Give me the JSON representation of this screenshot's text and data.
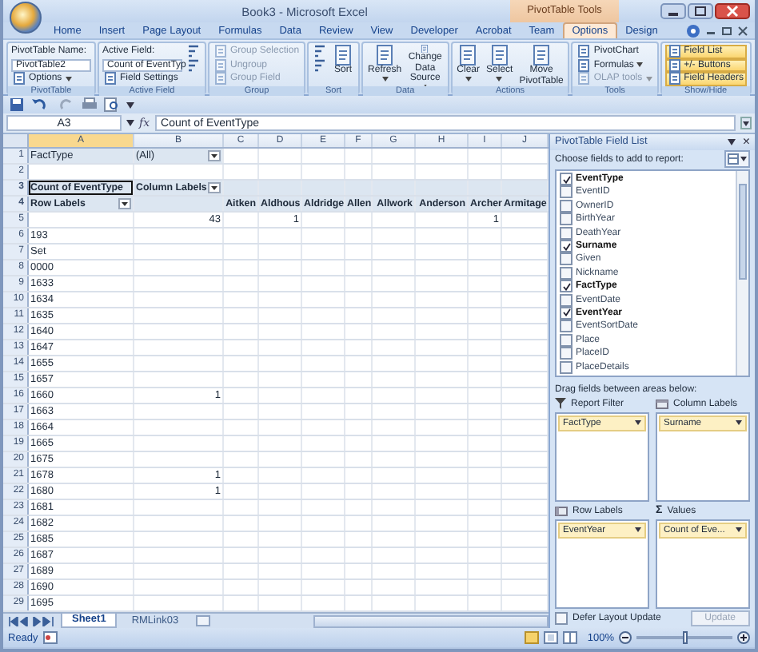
{
  "window": {
    "title": "Book3 - Microsoft Excel",
    "context_label": "PivotTable Tools"
  },
  "tabs": [
    {
      "label": "Home",
      "selected": false
    },
    {
      "label": "Insert",
      "selected": false
    },
    {
      "label": "Page Layout",
      "selected": false
    },
    {
      "label": "Formulas",
      "selected": false
    },
    {
      "label": "Data",
      "selected": false
    },
    {
      "label": "Review",
      "selected": false
    },
    {
      "label": "View",
      "selected": false
    },
    {
      "label": "Developer",
      "selected": false
    },
    {
      "label": "Acrobat",
      "selected": false
    },
    {
      "label": "Team",
      "selected": false
    },
    {
      "label": "Options",
      "selected": true
    },
    {
      "label": "Design",
      "selected": false
    }
  ],
  "ribbon": [
    {
      "label": "PivotTable",
      "items": [
        {
          "kind": "caption",
          "text": "PivotTable Name:"
        },
        {
          "kind": "field",
          "text": "PivotTable2"
        },
        {
          "kind": "small",
          "text": "Options",
          "menu": true,
          "disabled": false
        }
      ]
    },
    {
      "label": "Active Field",
      "items": [
        {
          "kind": "caption",
          "text": "Active Field:"
        },
        {
          "kind": "field",
          "text": "Count of EventTyp"
        },
        {
          "kind": "small",
          "text": "Field Settings",
          "menu": false,
          "disabled": false
        },
        {
          "kind": "icon",
          "disabled": false
        },
        {
          "kind": "icon",
          "disabled": false
        }
      ]
    },
    {
      "label": "Group",
      "items": [
        {
          "kind": "small",
          "text": "Group Selection",
          "menu": false,
          "disabled": true
        },
        {
          "kind": "small",
          "text": "Ungroup",
          "menu": false,
          "disabled": true
        },
        {
          "kind": "small",
          "text": "Group Field",
          "menu": false,
          "disabled": true
        }
      ]
    },
    {
      "label": "Sort",
      "items": [
        {
          "kind": "icon",
          "disabled": false
        },
        {
          "kind": "icon",
          "disabled": false
        },
        {
          "kind": "large",
          "text": "Sort",
          "menu": false,
          "disabled": false
        }
      ]
    },
    {
      "label": "Data",
      "items": [
        {
          "kind": "large",
          "text": "Refresh",
          "menu": true,
          "disabled": false
        },
        {
          "kind": "large",
          "text": "Change Data Source",
          "menu": true,
          "disabled": false
        }
      ]
    },
    {
      "label": "Actions",
      "items": [
        {
          "kind": "large",
          "text": "Clear",
          "menu": true,
          "disabled": false
        },
        {
          "kind": "large",
          "text": "Select",
          "menu": true,
          "disabled": false
        },
        {
          "kind": "large",
          "text": "Move PivotTable",
          "menu": false,
          "disabled": false
        }
      ]
    },
    {
      "label": "Tools",
      "items": [
        {
          "kind": "small",
          "text": "PivotChart",
          "menu": false,
          "disabled": false
        },
        {
          "kind": "small",
          "text": "Formulas",
          "menu": true,
          "disabled": false
        },
        {
          "kind": "small",
          "text": "OLAP tools",
          "menu": true,
          "disabled": true
        }
      ]
    },
    {
      "label": "Show/Hide",
      "items": [
        {
          "kind": "toggle",
          "text": "Field List",
          "on": true
        },
        {
          "kind": "toggle",
          "text": "+/- Buttons",
          "on": true
        },
        {
          "kind": "toggle",
          "text": "Field Headers",
          "on": true
        }
      ]
    }
  ],
  "formula_bar": {
    "name_box": "A3",
    "function_label": "fx",
    "value": "Count of EventType"
  },
  "columns": [
    "A",
    "B",
    "C",
    "D",
    "E",
    "F",
    "G",
    "H",
    "I",
    "J"
  ],
  "rows": [
    {
      "n": "1",
      "kind": "filter",
      "cells": [
        {
          "text": "FactType",
          "dropdown": false,
          "selected": false
        },
        {
          "text": "(All)",
          "dropdown": true,
          "selected": false
        }
      ]
    },
    {
      "n": "2",
      "kind": "data",
      "cells": []
    },
    {
      "n": "3",
      "kind": "header",
      "cells": [
        {
          "text": "Count of EventType",
          "dropdown": false,
          "selected": true
        },
        {
          "text": "Column Labels",
          "dropdown": true,
          "selected": false
        }
      ]
    },
    {
      "n": "4",
      "kind": "columns",
      "cells": [
        {
          "text": "Row Labels",
          "dropdown": true,
          "selected": false
        },
        null,
        {
          "text": "Aitken",
          "dropdown": false,
          "selected": false
        },
        {
          "text": "Aldhous",
          "dropdown": false,
          "selected": false
        },
        {
          "text": "Aldridge",
          "dropdown": false,
          "selected": false
        },
        {
          "text": "Allen",
          "dropdown": false,
          "selected": false
        },
        {
          "text": "Allwork",
          "dropdown": false,
          "selected": false
        },
        {
          "text": "Anderson",
          "dropdown": false,
          "selected": false
        },
        {
          "text": "Archer",
          "dropdown": false,
          "selected": false
        },
        {
          "text": "Armitage",
          "dropdown": false,
          "selected": false
        }
      ]
    },
    {
      "n": "5",
      "kind": "data",
      "cells": [
        null,
        {
          "text": "43",
          "dropdown": false,
          "selected": false
        },
        null,
        {
          "text": "1",
          "dropdown": false,
          "selected": false
        },
        null,
        null,
        null,
        null,
        {
          "text": "1",
          "dropdown": false,
          "selected": false
        }
      ]
    },
    {
      "n": "6",
      "kind": "data",
      "cells": [
        {
          "text": "193",
          "dropdown": false,
          "selected": false
        }
      ]
    },
    {
      "n": "7",
      "kind": "data",
      "cells": [
        {
          "text": "Set",
          "dropdown": false,
          "selected": false
        }
      ]
    },
    {
      "n": "8",
      "kind": "data",
      "cells": [
        {
          "text": "0000",
          "dropdown": false,
          "selected": false
        }
      ]
    },
    {
      "n": "9",
      "kind": "data",
      "cells": [
        {
          "text": "1633",
          "dropdown": false,
          "selected": false
        }
      ]
    },
    {
      "n": "10",
      "kind": "data",
      "cells": [
        {
          "text": "1634",
          "dropdown": false,
          "selected": false
        }
      ]
    },
    {
      "n": "11",
      "kind": "data",
      "cells": [
        {
          "text": "1635",
          "dropdown": false,
          "selected": false
        }
      ]
    },
    {
      "n": "12",
      "kind": "data",
      "cells": [
        {
          "text": "1640",
          "dropdown": false,
          "selected": false
        }
      ]
    },
    {
      "n": "13",
      "kind": "data",
      "cells": [
        {
          "text": "1647",
          "dropdown": false,
          "selected": false
        }
      ]
    },
    {
      "n": "14",
      "kind": "data",
      "cells": [
        {
          "text": "1655",
          "dropdown": false,
          "selected": false
        }
      ]
    },
    {
      "n": "15",
      "kind": "data",
      "cells": [
        {
          "text": "1657",
          "dropdown": false,
          "selected": false
        }
      ]
    },
    {
      "n": "16",
      "kind": "data",
      "cells": [
        {
          "text": "1660",
          "dropdown": false,
          "selected": false
        },
        {
          "text": "1",
          "dropdown": false,
          "selected": false
        }
      ]
    },
    {
      "n": "17",
      "kind": "data",
      "cells": [
        {
          "text": "1663",
          "dropdown": false,
          "selected": false
        }
      ]
    },
    {
      "n": "18",
      "kind": "data",
      "cells": [
        {
          "text": "1664",
          "dropdown": false,
          "selected": false
        }
      ]
    },
    {
      "n": "19",
      "kind": "data",
      "cells": [
        {
          "text": "1665",
          "dropdown": false,
          "selected": false
        }
      ]
    },
    {
      "n": "20",
      "kind": "data",
      "cells": [
        {
          "text": "1675",
          "dropdown": false,
          "selected": false
        }
      ]
    },
    {
      "n": "21",
      "kind": "data",
      "cells": [
        {
          "text": "1678",
          "dropdown": false,
          "selected": false
        },
        {
          "text": "1",
          "dropdown": false,
          "selected": false
        }
      ]
    },
    {
      "n": "22",
      "kind": "data",
      "cells": [
        {
          "text": "1680",
          "dropdown": false,
          "selected": false
        },
        {
          "text": "1",
          "dropdown": false,
          "selected": false
        }
      ]
    },
    {
      "n": "23",
      "kind": "data",
      "cells": [
        {
          "text": "1681",
          "dropdown": false,
          "selected": false
        }
      ]
    },
    {
      "n": "24",
      "kind": "data",
      "cells": [
        {
          "text": "1682",
          "dropdown": false,
          "selected": false
        }
      ]
    },
    {
      "n": "25",
      "kind": "data",
      "cells": [
        {
          "text": "1685",
          "dropdown": false,
          "selected": false
        }
      ]
    },
    {
      "n": "26",
      "kind": "data",
      "cells": [
        {
          "text": "1687",
          "dropdown": false,
          "selected": false
        }
      ]
    },
    {
      "n": "27",
      "kind": "data",
      "cells": [
        {
          "text": "1689",
          "dropdown": false,
          "selected": false
        }
      ]
    },
    {
      "n": "28",
      "kind": "data",
      "cells": [
        {
          "text": "1690",
          "dropdown": false,
          "selected": false
        }
      ]
    },
    {
      "n": "29",
      "kind": "data",
      "cells": [
        {
          "text": "1695",
          "dropdown": false,
          "selected": false
        }
      ]
    }
  ],
  "sheet_tabs": [
    {
      "label": "Sheet1",
      "selected": true
    },
    {
      "label": "RMLink03",
      "selected": false
    }
  ],
  "field_list": {
    "title": "PivotTable Field List",
    "close": "×",
    "choose_label": "Choose fields to add to report:",
    "fields": [
      {
        "name": "EventType",
        "checked": true
      },
      {
        "name": "EventID",
        "checked": false
      },
      {
        "name": "OwnerID",
        "checked": false
      },
      {
        "name": "BirthYear",
        "checked": false
      },
      {
        "name": "DeathYear",
        "checked": false
      },
      {
        "name": "Surname",
        "checked": true
      },
      {
        "name": "Given",
        "checked": false
      },
      {
        "name": "Nickname",
        "checked": false
      },
      {
        "name": "FactType",
        "checked": true
      },
      {
        "name": "EventDate",
        "checked": false
      },
      {
        "name": "EventYear",
        "checked": true
      },
      {
        "name": "EventSortDate",
        "checked": false
      },
      {
        "name": "Place",
        "checked": false
      },
      {
        "name": "PlaceID",
        "checked": false
      },
      {
        "name": "PlaceDetails",
        "checked": false
      }
    ],
    "drag_label": "Drag fields between areas below:",
    "areas": [
      {
        "kind": "filter",
        "label": "Report Filter",
        "fields": [
          "FactType"
        ]
      },
      {
        "kind": "columns",
        "label": "Column Labels",
        "fields": [
          "Surname"
        ]
      },
      {
        "kind": "rows",
        "label": "Row Labels",
        "fields": [
          "EventYear"
        ]
      },
      {
        "kind": "values",
        "label": "Values",
        "symbol": "Σ",
        "fields": [
          "Count of Eve..."
        ]
      }
    ],
    "defer": {
      "label": "Defer Layout Update",
      "checked": false
    },
    "update": {
      "label": "Update",
      "disabled": true
    }
  },
  "status_bar": {
    "text": "Ready",
    "zoom": {
      "reading": "100%",
      "level": 0.5
    }
  }
}
